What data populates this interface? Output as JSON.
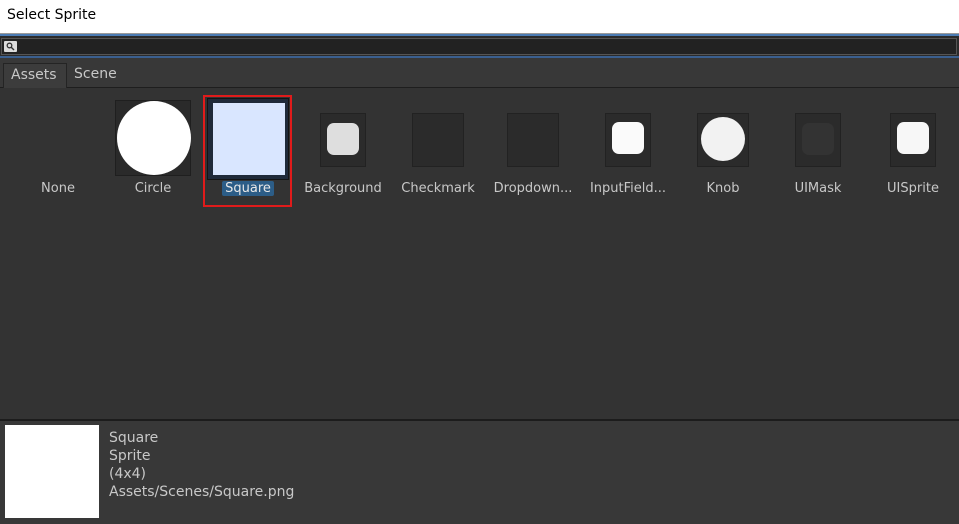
{
  "window": {
    "title": "Select Sprite"
  },
  "search": {
    "placeholder": "",
    "value": ""
  },
  "tabs": [
    {
      "label": "Assets",
      "active": true
    },
    {
      "label": "Scene",
      "active": false
    }
  ],
  "items": [
    {
      "label": "None",
      "icon": "none"
    },
    {
      "label": "Circle",
      "icon": "circle-sprite"
    },
    {
      "label": "Square",
      "icon": "square-sprite",
      "selected": true
    },
    {
      "label": "Background",
      "icon": "background-sprite"
    },
    {
      "label": "Checkmark",
      "icon": "checkmark-sprite"
    },
    {
      "label": "Dropdown...",
      "icon": "dropdown-sprite"
    },
    {
      "label": "InputField...",
      "icon": "inputfield-sprite"
    },
    {
      "label": "Knob",
      "icon": "knob-sprite"
    },
    {
      "label": "UIMask",
      "icon": "uimask-sprite"
    },
    {
      "label": "UISprite",
      "icon": "uisprite-sprite"
    }
  ],
  "preview": {
    "name": "Square",
    "type": "Sprite",
    "size": "(4x4)",
    "path": "Assets/Scenes/Square.png"
  },
  "colors": {
    "selection_outline": "#e01b1b",
    "selection_label": "#2c5d87",
    "square_fill": "#d9e6ff"
  }
}
